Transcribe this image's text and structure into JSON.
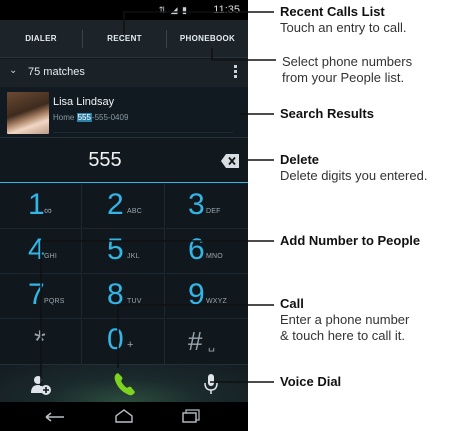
{
  "statusbar": {
    "icons": "⇅ ◢ ▮",
    "time": "11:35"
  },
  "tabs": [
    {
      "label": "DIALER"
    },
    {
      "label": "RECENT"
    },
    {
      "label": "PHONEBOOK"
    }
  ],
  "matches": {
    "text": "75 matches"
  },
  "search_result": {
    "name": "Lisa Lindsay",
    "number_prefix": "Home ",
    "number_match": "555",
    "number_rest": "-555-0409"
  },
  "dialer": {
    "digits": "555"
  },
  "keypad": [
    {
      "digit": "1",
      "letters": "∞"
    },
    {
      "digit": "2",
      "letters": "ABC"
    },
    {
      "digit": "3",
      "letters": "DEF"
    },
    {
      "digit": "4",
      "letters": "GHI"
    },
    {
      "digit": "5",
      "letters": "JKL"
    },
    {
      "digit": "6",
      "letters": "MNO"
    },
    {
      "digit": "7",
      "letters": "PQRS"
    },
    {
      "digit": "8",
      "letters": "TUV"
    },
    {
      "digit": "9",
      "letters": "WXYZ"
    },
    {
      "digit": "*",
      "letters": ""
    },
    {
      "digit": "0",
      "letters": "+"
    },
    {
      "digit": "#",
      "letters": "␣"
    }
  ],
  "callouts": {
    "recent": {
      "title": "Recent Calls List",
      "desc": "Touch an entry to call."
    },
    "phonebook": {
      "desc1": "Select phone numbers",
      "desc2": "from your People list."
    },
    "search": {
      "title": "Search Results"
    },
    "delete": {
      "title": "Delete",
      "desc": "Delete digits you entered."
    },
    "add": {
      "title": "Add Number to People"
    },
    "call": {
      "title": "Call",
      "desc1": "Enter a phone number",
      "desc2": "& touch here to call it."
    },
    "voice": {
      "title": "Voice Dial"
    }
  },
  "colors": {
    "accent": "#33b5e5",
    "call_green": "#7ed321",
    "background": "#0f1a22"
  },
  "icons": [
    "chevron-down-icon",
    "overflow-menu-icon",
    "backspace-icon",
    "add-person-icon",
    "phone-icon",
    "microphone-icon",
    "back-icon",
    "home-icon",
    "recent-apps-icon"
  ]
}
